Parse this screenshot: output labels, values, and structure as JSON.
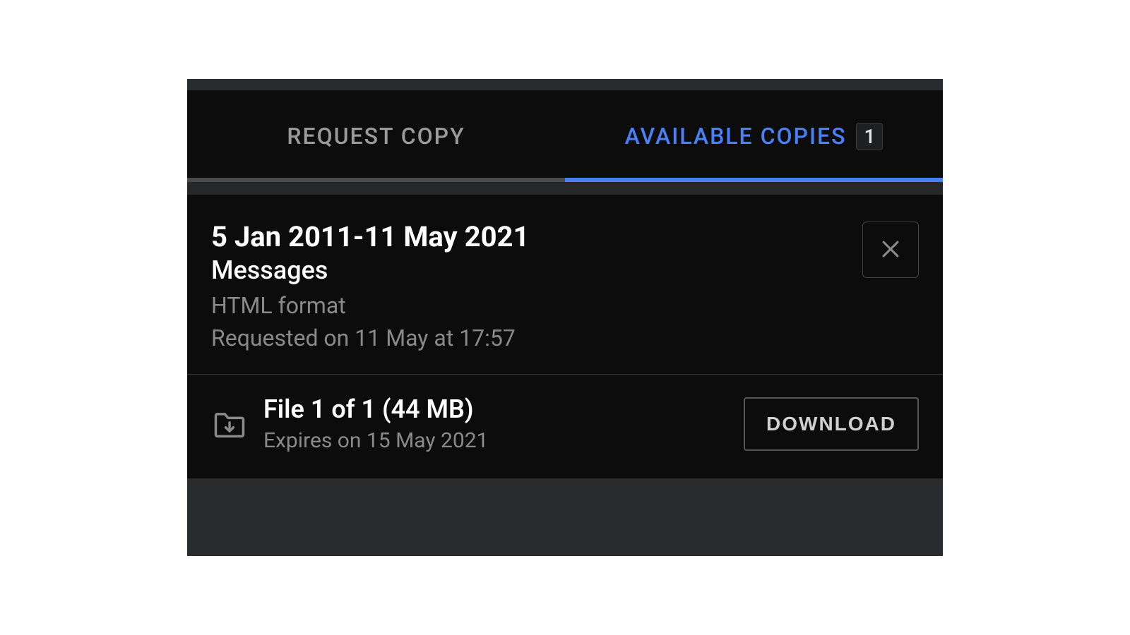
{
  "tabs": {
    "request": "REQUEST COPY",
    "available": "AVAILABLE COPIES",
    "available_count": "1"
  },
  "copy": {
    "date_range": "5 Jan 2011-11 May 2021",
    "category": "Messages",
    "format": "HTML format",
    "requested": "Requested on 11 May at 17:57"
  },
  "file": {
    "title": "File 1 of 1 (44 MB)",
    "expires": "Expires on 15 May 2021",
    "download_label": "DOWNLOAD"
  }
}
